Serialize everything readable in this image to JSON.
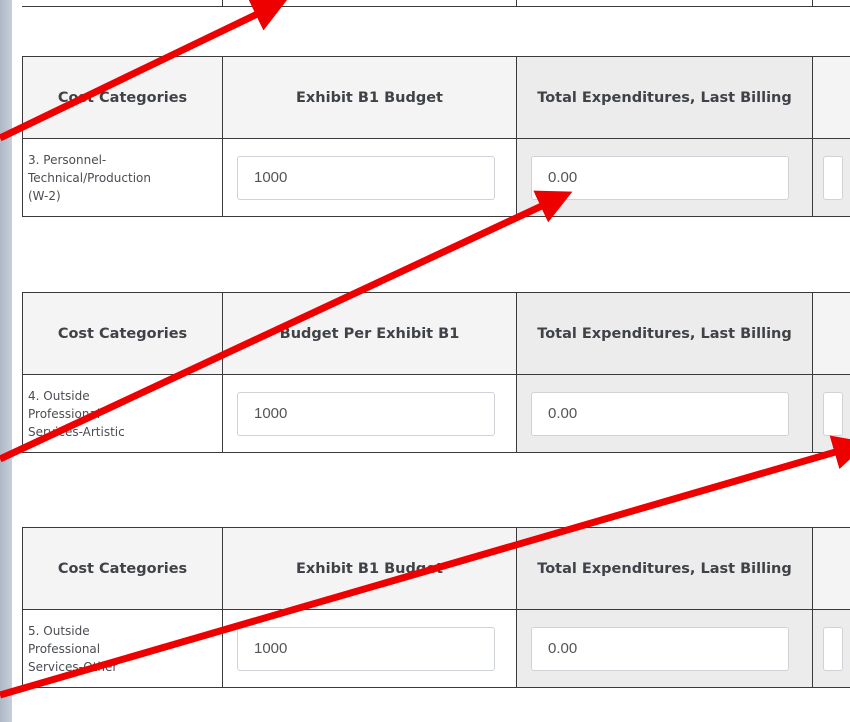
{
  "tables": [
    {
      "headers": [
        "Cost Categories",
        "Exhibit B1 Budget",
        "Total Expenditures, Last Billing",
        ""
      ],
      "row": {
        "category": [
          "3. Personnel-",
          "Technical/Production",
          "(W-2)"
        ],
        "budget": "1000",
        "last_billing": "0.00"
      }
    },
    {
      "headers": [
        "Cost Categories",
        "Budget Per Exhibit B1",
        "Total Expenditures, Last Billing",
        ""
      ],
      "row": {
        "category": [
          "4. Outside",
          "Professional",
          "Services-Artistic"
        ],
        "budget": "1000",
        "last_billing": "0.00"
      }
    },
    {
      "headers": [
        "Cost Categories",
        "Exhibit B1 Budget",
        "Total Expenditures, Last Billing",
        ""
      ],
      "row": {
        "category": [
          "5. Outside",
          "Professional",
          "Services-Other"
        ],
        "budget": "1000",
        "last_billing": "0.00"
      }
    }
  ],
  "colors": {
    "arrow": "#ee0000",
    "border": "#3a3a3a",
    "header_shaded": "#ececec"
  }
}
